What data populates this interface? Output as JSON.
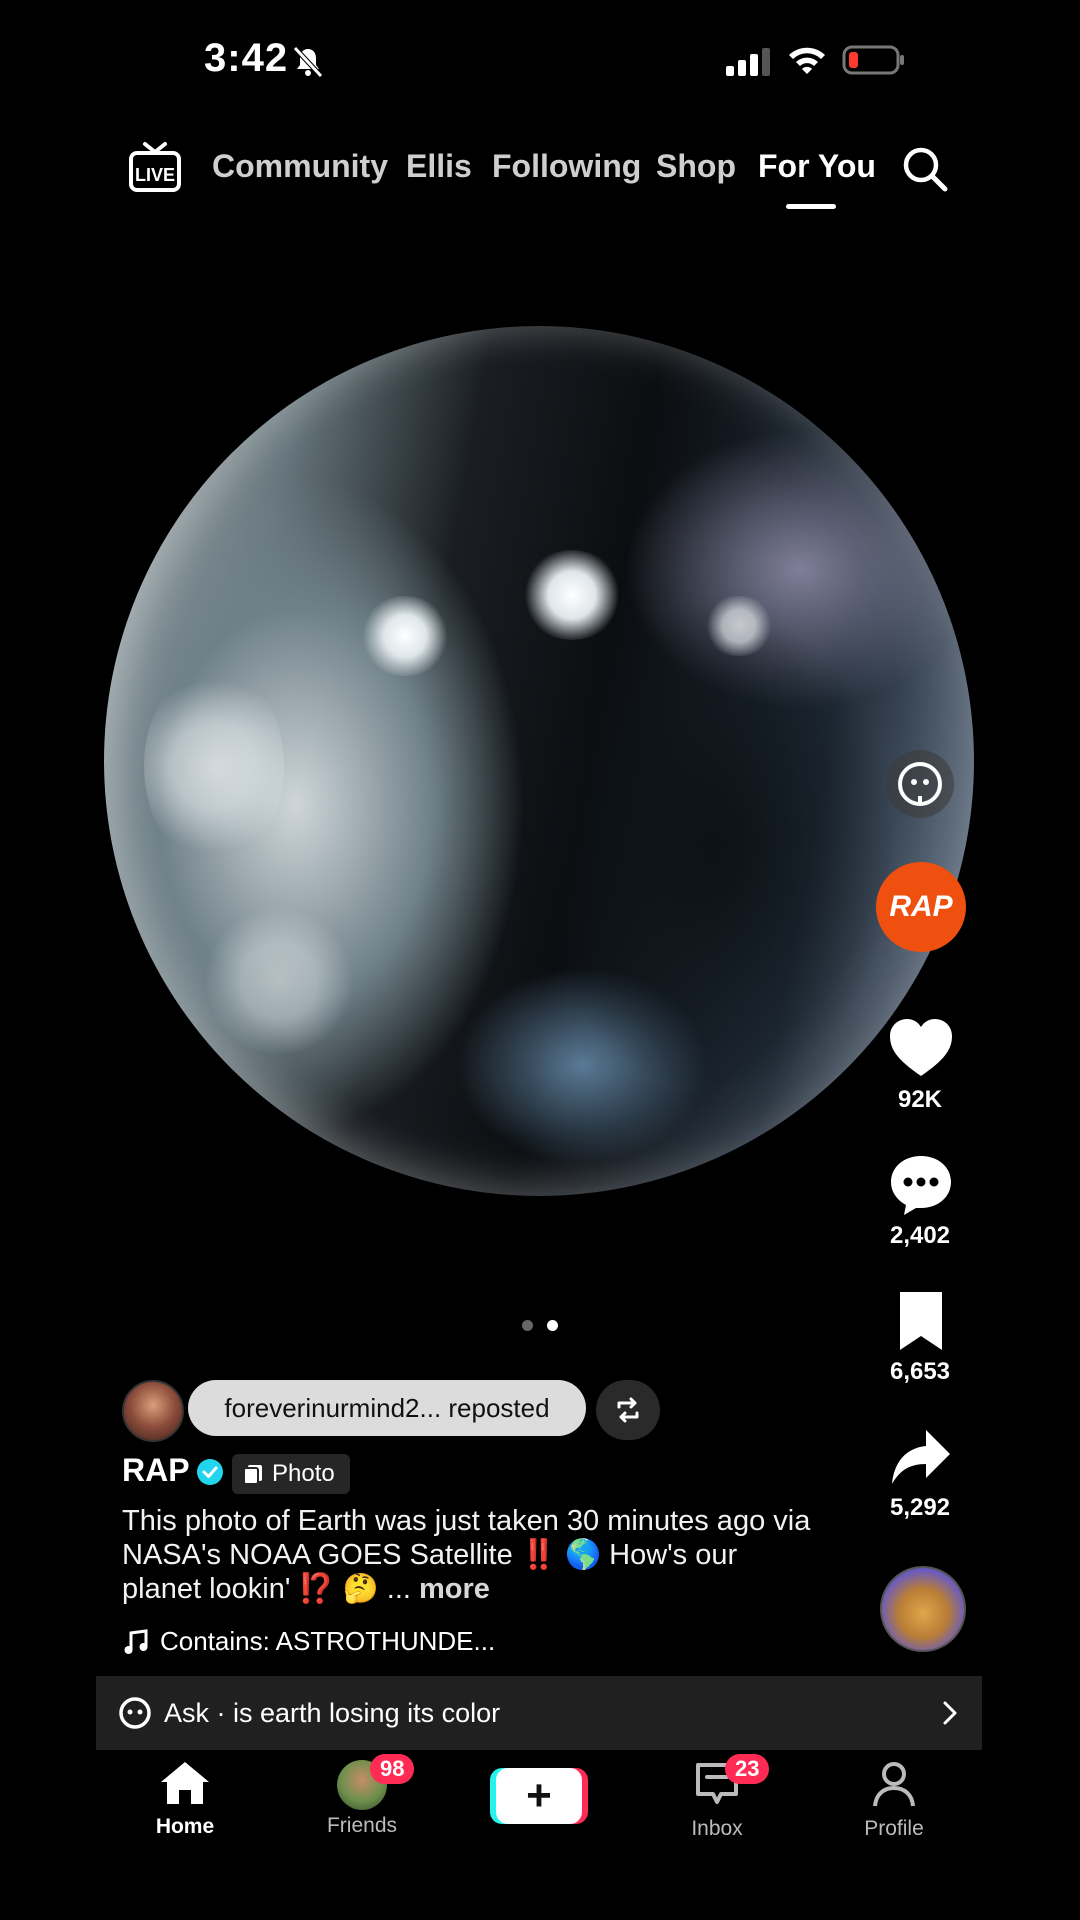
{
  "status_bar": {
    "time": "3:42"
  },
  "top_nav": {
    "live_label": "LIVE",
    "tabs": [
      {
        "label": "Community"
      },
      {
        "label": "Ellis"
      },
      {
        "label": "Following"
      },
      {
        "label": "Shop"
      },
      {
        "label": "For You",
        "active": true
      }
    ]
  },
  "post": {
    "repost_text": "foreverinurmind2... reposted",
    "author": "RAP",
    "type_badge": "Photo",
    "caption_text": "This photo of Earth was just taken 30 minutes ago via NASA's NOAA GOES Satellite ‼️ 🌎 How's our planet lookin' ⁉️ 🤔 ...",
    "caption_more": "more",
    "music": "Contains: ASTROTHUNDE...",
    "creator_logo_text": "RAP",
    "page_dots": {
      "count": 2,
      "active_index": 1
    }
  },
  "actions": {
    "likes": "92K",
    "comments": "2,402",
    "saves": "6,653",
    "shares": "5,292"
  },
  "ask_bar": {
    "text": "Ask · is earth losing its color"
  },
  "tab_bar": {
    "items": [
      {
        "label": "Home",
        "active": true
      },
      {
        "label": "Friends",
        "badge": "98"
      },
      {
        "label": ""
      },
      {
        "label": "Inbox",
        "badge": "23"
      },
      {
        "label": "Profile"
      }
    ]
  },
  "colors": {
    "accent_pink": "#fe2c55",
    "accent_cyan": "#25f4ee",
    "brand_orange": "#f0500f",
    "verified_blue": "#20d5ec"
  }
}
